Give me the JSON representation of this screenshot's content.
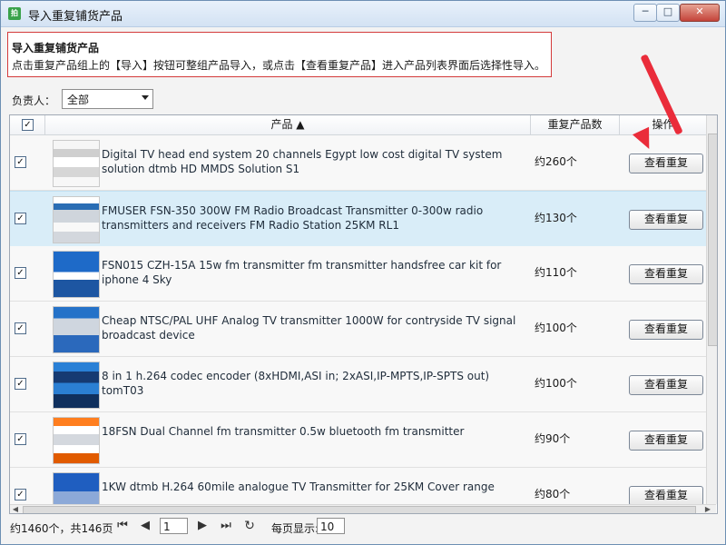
{
  "window": {
    "title": "导入重复铺货产品",
    "icon_name": "app-icon",
    "min_label": "─",
    "max_label": "□",
    "close_label": "✕"
  },
  "info": {
    "title": "导入重复铺货产品",
    "description": "点击重复产品组上的【导入】按钮可整组产品导入，或点击【查看重复产品】进入产品列表界面后选择性导入。"
  },
  "filter": {
    "label": "负责人：",
    "value": "全部"
  },
  "table": {
    "headers": {
      "product": "产品 ▲",
      "count": "重复产品数",
      "action": "操作"
    },
    "rows": [
      {
        "checked": "✓",
        "name": "Digital TV head end system 20 channels Egypt low cost digital TV system solution dtmb HD MMDS Solution S1",
        "count": "约260个",
        "action": "查看重复"
      },
      {
        "checked": "✓",
        "name": "FMUSER FSN-350 300W FM Radio Broadcast Transmitter 0-300w radio transmitters and receivers FM Radio Station 25KM RL1",
        "count": "约130个",
        "action": "查看重复"
      },
      {
        "checked": "✓",
        "name": "FSN015 CZH-15A 15w fm transmitter fm transmitter handsfree car kit for iphone 4 Sky",
        "count": "约110个",
        "action": "查看重复"
      },
      {
        "checked": "✓",
        "name": "Cheap NTSC/PAL UHF Analog TV transmitter 1000W for contryside TV signal broadcast device",
        "count": "约100个",
        "action": "查看重复"
      },
      {
        "checked": "✓",
        "name": "8 in 1 h.264 codec encoder (8xHDMI,ASI in; 2xASI,IP-MPTS,IP-SPTS out) tomT03",
        "count": "约100个",
        "action": "查看重复"
      },
      {
        "checked": "✓",
        "name": "18FSN Dual Channel fm transmitter 0.5w bluetooth fm transmitter",
        "count": "约90个",
        "action": "查看重复"
      },
      {
        "checked": "✓",
        "name": "1KW dtmb H.264 60mile analogue TV Transmitter for 25KM Cover range",
        "count": "约80个",
        "action": "查看重复"
      }
    ]
  },
  "pager": {
    "summary": "约1460个，共146页",
    "page": "1",
    "per_page_label": "每页显示:",
    "per_page": "10"
  }
}
